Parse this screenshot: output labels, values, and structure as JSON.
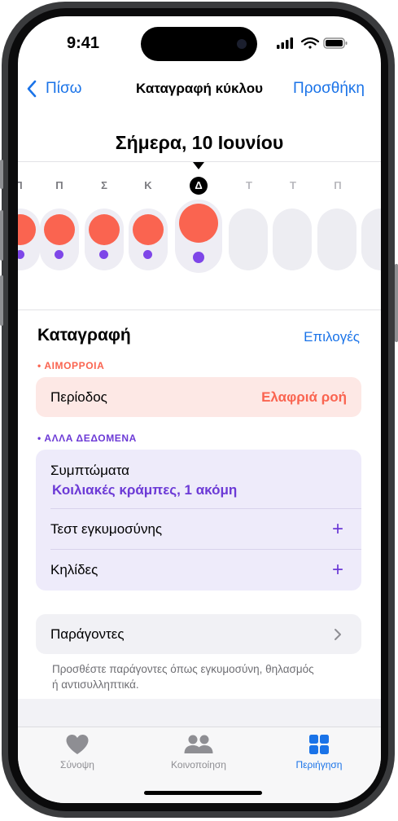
{
  "status_bar": {
    "time": "9:41"
  },
  "nav": {
    "back_label": "Πίσω",
    "title": "Καταγραφή κύκλου",
    "add_label": "Προσθήκη"
  },
  "date_heading": "Σήμερα, 10 Ιουνίου",
  "calendar": {
    "day_letters": [
      "Π",
      "Π",
      "Σ",
      "Κ",
      "Δ",
      "Τ",
      "Τ",
      "Π"
    ],
    "today_index": 4
  },
  "log": {
    "title": "Καταγραφή",
    "options_label": "Επιλογές",
    "bleeding": {
      "category_label": "ΑΙΜΟΡΡΟΙΑ",
      "row_label": "Περίοδος",
      "row_value": "Ελαφριά ροή",
      "color": "#fa6450"
    },
    "other": {
      "category_label": "ΑΛΛΑ ΔΕΔΟΜΕΝΑ",
      "color": "#6c3ad6",
      "symptoms_label": "Συμπτώματα",
      "symptoms_value": "Κοιλιακές κράμπες, 1 ακόμη",
      "pregnancy_test_label": "Τεστ εγκυμοσύνης",
      "spotting_label": "Κηλίδες"
    },
    "factors": {
      "label": "Παράγοντες",
      "note": "Προσθέστε παράγοντες όπως εγκυμοσύνη, θηλασμός ή αντισυλληπτικά."
    }
  },
  "tabbar": {
    "tabs": [
      {
        "label": "Σύνοψη",
        "icon": "heart-icon"
      },
      {
        "label": "Κοινοποίηση",
        "icon": "people-icon"
      },
      {
        "label": "Περιήγηση",
        "icon": "grid-icon"
      }
    ],
    "active_color": "#1a73e8",
    "inactive_color": "#8e8e93"
  }
}
